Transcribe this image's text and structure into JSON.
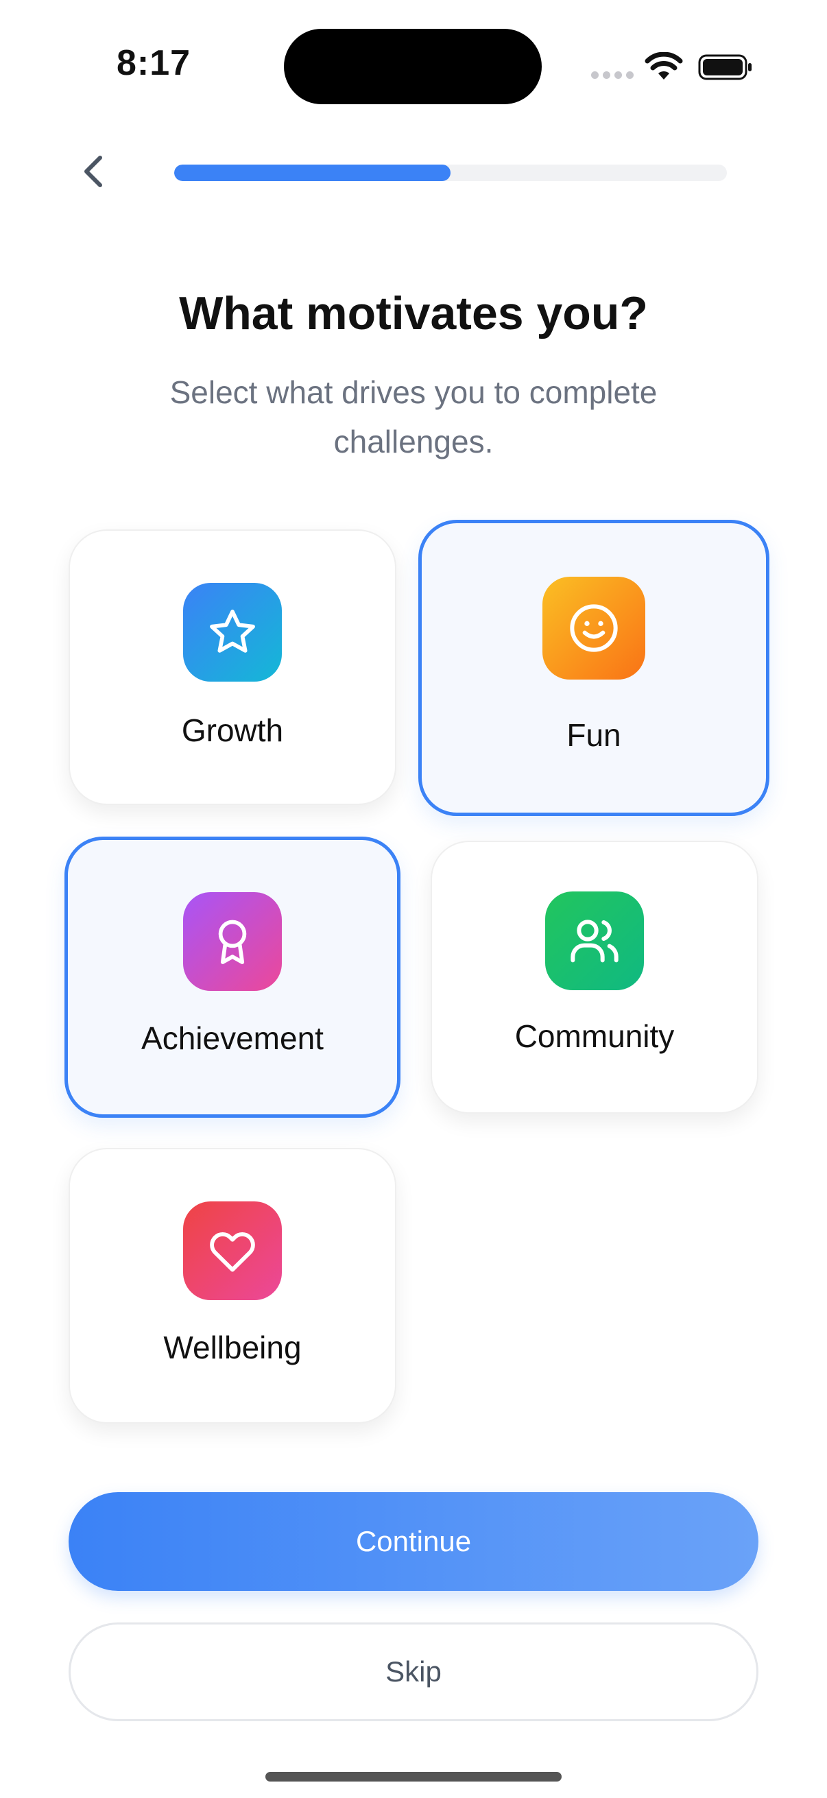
{
  "status_bar": {
    "time": "8:17"
  },
  "header": {
    "progress": 0.5,
    "progress_color": "#3b82f6"
  },
  "title": "What motivates you?",
  "subtitle": "Select what drives you to complete challenges.",
  "options": [
    {
      "label": "Growth",
      "icon": "star-icon",
      "selected": false,
      "gradient": [
        "#3b82f6",
        "#14b8d6"
      ]
    },
    {
      "label": "Fun",
      "icon": "smile-icon",
      "selected": true,
      "gradient": [
        "#fbbf24",
        "#f97316"
      ]
    },
    {
      "label": "Achievement",
      "icon": "award-icon",
      "selected": true,
      "gradient": [
        "#a855f7",
        "#ec4899"
      ]
    },
    {
      "label": "Community",
      "icon": "users-icon",
      "selected": false,
      "gradient": [
        "#22c55e",
        "#10b981"
      ]
    },
    {
      "label": "Wellbeing",
      "icon": "heart-icon",
      "selected": false,
      "gradient": [
        "#ef4444",
        "#ec4899"
      ]
    }
  ],
  "buttons": {
    "continue_label": "Continue",
    "skip_label": "Skip"
  }
}
